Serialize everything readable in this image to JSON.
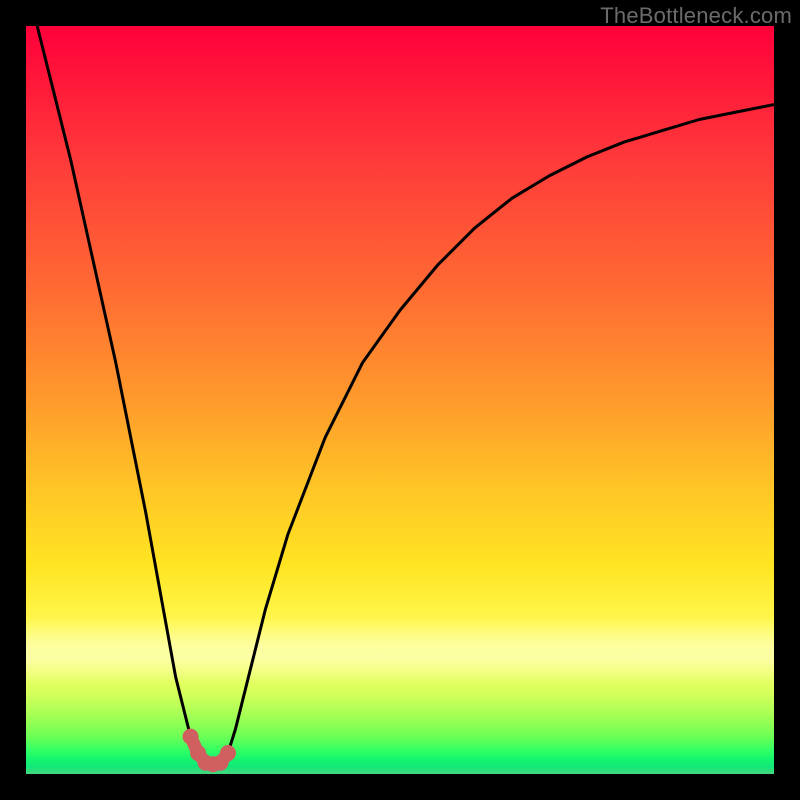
{
  "watermark": "TheBottleneck.com",
  "colors": {
    "curve": "#000000",
    "marker": "#d05f5f",
    "frame": "#000000"
  },
  "chart_data": {
    "type": "line",
    "title": "",
    "xlabel": "",
    "ylabel": "",
    "xlim": [
      0,
      100
    ],
    "ylim": [
      0,
      100
    ],
    "grid": false,
    "legend": false,
    "series": [
      {
        "name": "bottleneck-curve",
        "x": [
          0,
          2,
          4,
          6,
          8,
          10,
          12,
          14,
          16,
          18,
          20,
          22,
          23,
          24,
          25,
          26,
          27,
          28,
          30,
          32,
          35,
          40,
          45,
          50,
          55,
          60,
          65,
          70,
          75,
          80,
          85,
          90,
          95,
          100
        ],
        "values": [
          106,
          98,
          90,
          82,
          73,
          64,
          55,
          45,
          35,
          24,
          13,
          5,
          2.8,
          1.5,
          1.3,
          1.5,
          2.8,
          6,
          14,
          22,
          32,
          45,
          55,
          62,
          68,
          73,
          77,
          80,
          82.5,
          84.5,
          86,
          87.5,
          88.5,
          89.5
        ]
      }
    ],
    "markers": {
      "name": "optimal-range",
      "x": [
        22,
        23,
        24,
        25,
        26,
        27
      ],
      "values": [
        5,
        2.8,
        1.5,
        1.3,
        1.5,
        2.8
      ],
      "color": "#d05f5f"
    },
    "background_gradient": {
      "top": "#ff003a",
      "mid": "#ffe422",
      "bottom": "#10e978"
    }
  }
}
